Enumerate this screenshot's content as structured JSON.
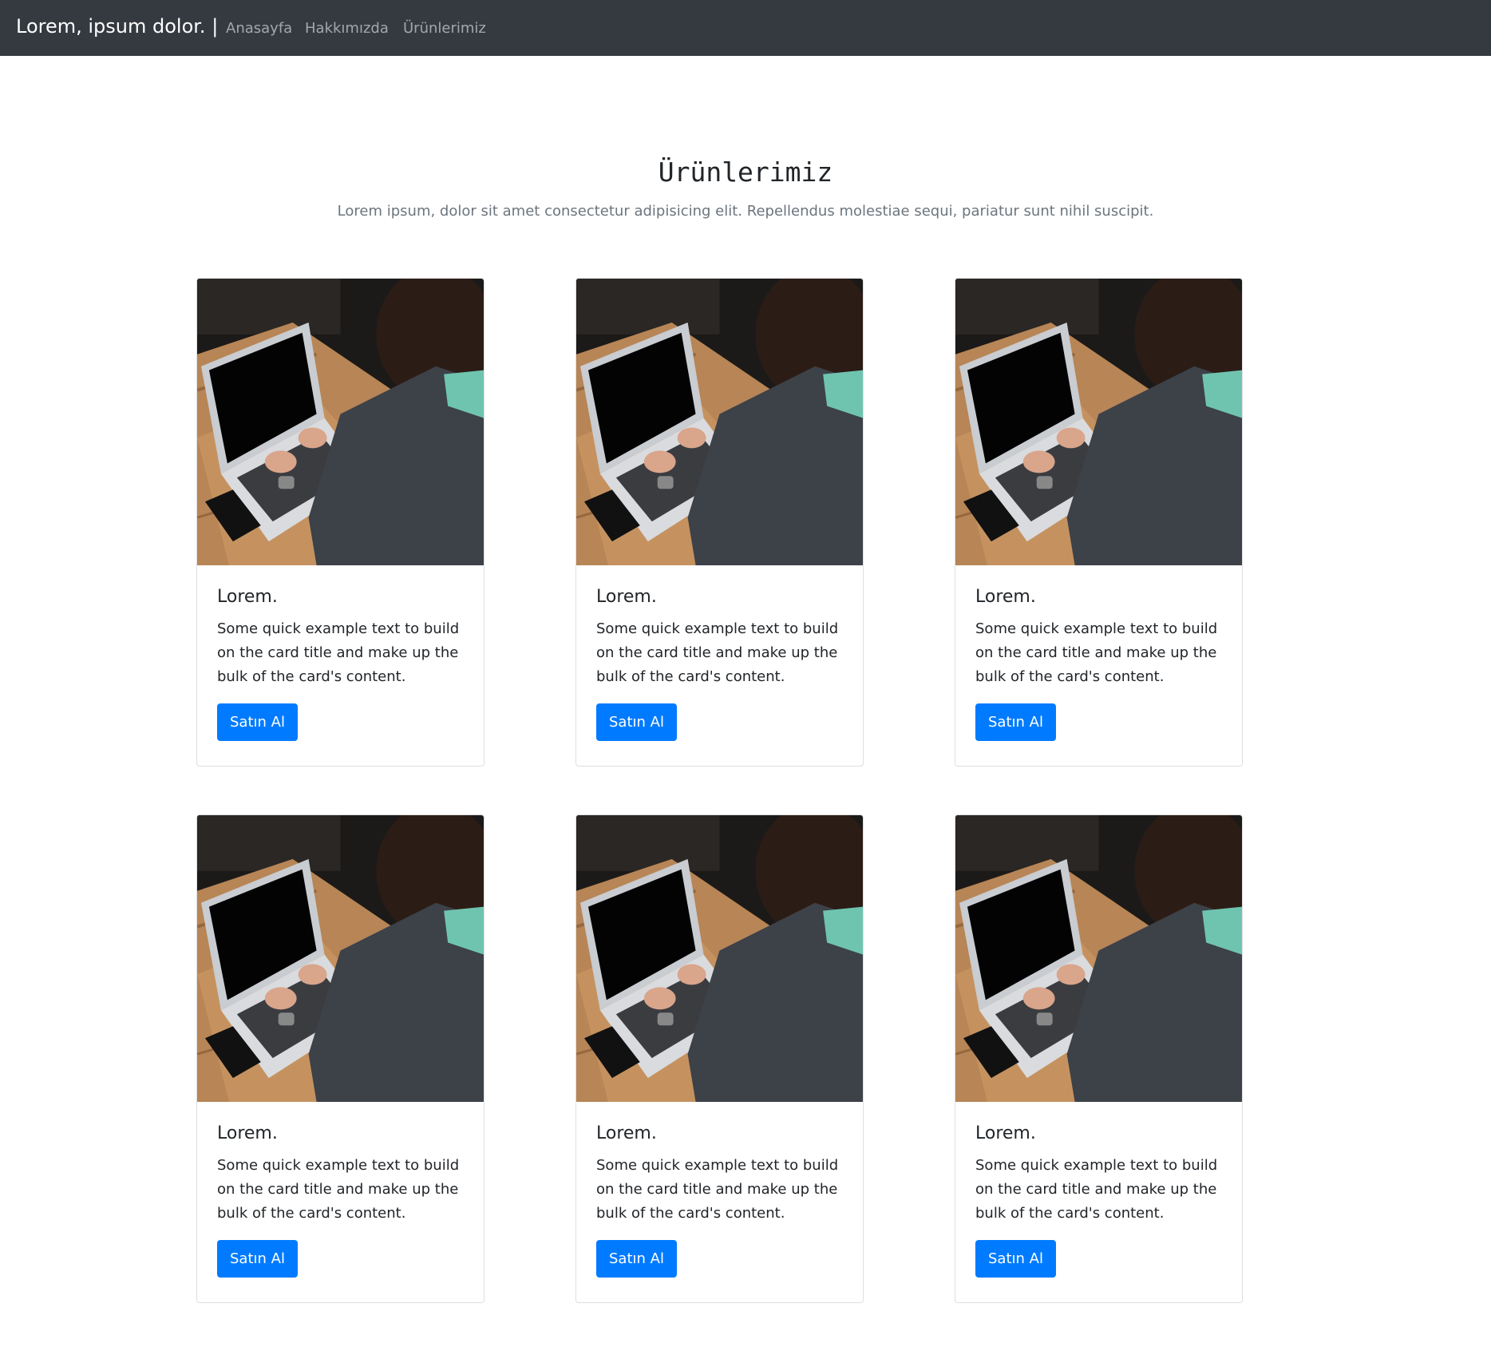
{
  "navbar": {
    "brand": "Lorem, ipsum dolor. |",
    "links": [
      "Anasayfa",
      "Hakkımızda",
      "Ürünlerimiz"
    ]
  },
  "main": {
    "title": "Ürünlerimiz",
    "subtitle": "Lorem ipsum, dolor sit amet consectetur adipisicing elit. Repellendus molestiae sequi, pariatur sunt nihil suscipit.",
    "cards": [
      {
        "title": "Lorem.",
        "text": "Some quick example text to build on the card title and make up the bulk of the card's content.",
        "button": "Satın Al"
      },
      {
        "title": "Lorem.",
        "text": "Some quick example text to build on the card title and make up the bulk of the card's content.",
        "button": "Satın Al"
      },
      {
        "title": "Lorem.",
        "text": "Some quick example text to build on the card title and make up the bulk of the card's content.",
        "button": "Satın Al"
      },
      {
        "title": "Lorem.",
        "text": "Some quick example text to build on the card title and make up the bulk of the card's content.",
        "button": "Satın Al"
      },
      {
        "title": "Lorem.",
        "text": "Some quick example text to build on the card title and make up the bulk of the card's content.",
        "button": "Satın Al"
      },
      {
        "title": "Lorem.",
        "text": "Some quick example text to build on the card title and make up the bulk of the card's content.",
        "button": "Satın Al"
      }
    ]
  },
  "colors": {
    "navbar_bg": "#343a40",
    "button_primary": "#007bff",
    "muted_text": "#6c757d"
  }
}
